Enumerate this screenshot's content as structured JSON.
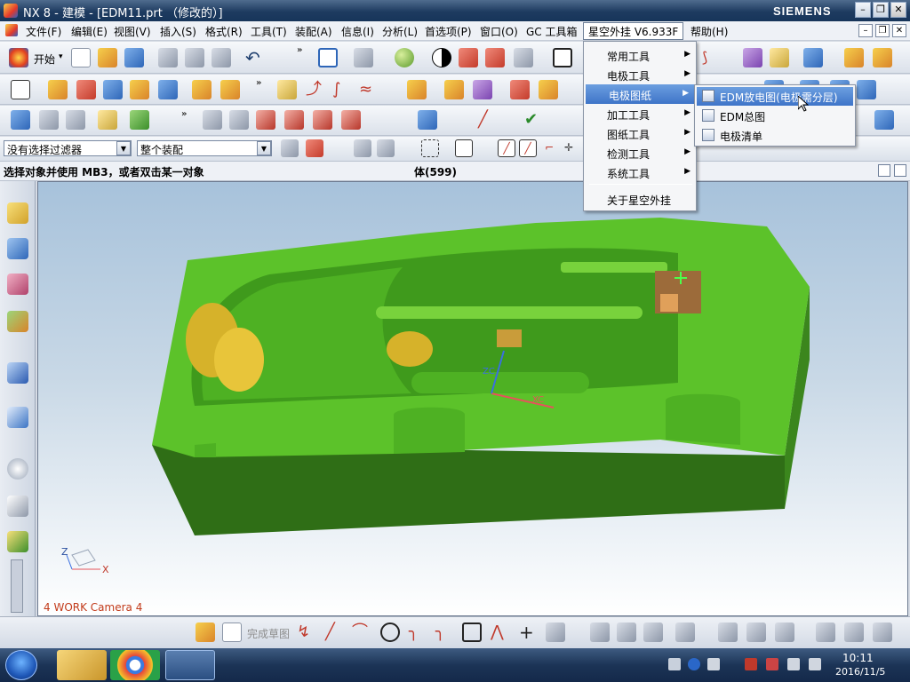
{
  "window": {
    "title": "NX 8 - 建模 - [EDM11.prt （修改的）]",
    "brand": "SIEMENS",
    "minimize": "–",
    "maximize": "❐",
    "close": "✕"
  },
  "menubar": {
    "items": [
      "文件(F)",
      "编辑(E)",
      "视图(V)",
      "插入(S)",
      "格式(R)",
      "工具(T)",
      "装配(A)",
      "信息(I)",
      "分析(L)",
      "首选项(P)",
      "窗口(O)",
      "GC 工具箱",
      "星空外挂 V6.933F",
      "帮助(H)"
    ],
    "mdi_min": "–",
    "mdi_restore": "❐",
    "mdi_close": "✕"
  },
  "toolbar": {
    "start_label": "开始",
    "start_caret": "▾"
  },
  "filter": {
    "selection_filter": "没有选择过滤器",
    "assembly_scope": "整个装配"
  },
  "status": {
    "prompt": "选择对象并使用 MB3，或者双击某一对象",
    "count": "体(599)"
  },
  "dropdown_menu": {
    "items": [
      {
        "label": "常用工具",
        "submenu": true
      },
      {
        "label": "电极工具",
        "submenu": true
      },
      {
        "label": "电极图纸",
        "submenu": true,
        "highlighted": true
      },
      {
        "label": "加工工具",
        "submenu": true
      },
      {
        "label": "图纸工具",
        "submenu": true
      },
      {
        "label": "检测工具",
        "submenu": true
      },
      {
        "label": "系统工具",
        "submenu": true
      }
    ],
    "about": "关于星空外挂",
    "arrow_glyph": "▶"
  },
  "submenu": {
    "items": [
      {
        "label": "EDM放电图(电极需分层)",
        "highlighted": true
      },
      {
        "label": "EDM总图"
      },
      {
        "label": "电极清单"
      }
    ]
  },
  "viewport": {
    "camera_label": "4 WORK Camera 4",
    "axis_x": "X",
    "axis_z": "Z",
    "part_label_xc": "XC",
    "part_label_zc": "ZC"
  },
  "bottom_toolbar": {
    "sketch_label": "完成草图"
  },
  "taskbar": {
    "time": "10:11",
    "date": "2016/11/5"
  },
  "colors": {
    "part_green": "#5cc22a",
    "menu_highlight": "#3e74c8",
    "titlebar": "#1e3b60",
    "camera_label": "#c23b1b"
  }
}
